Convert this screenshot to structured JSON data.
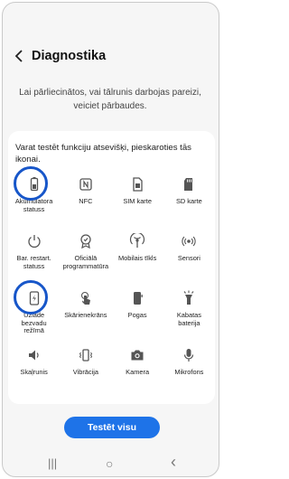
{
  "header": {
    "title": "Diagnostika"
  },
  "intro": {
    "text": "Lai pārliecinātos, vai tālrunis darbojas pareizi, veiciet pārbaudes."
  },
  "card": {
    "description": "Varat testēt funkciju atsevišķi, pieskaroties tās ikonai.",
    "items": [
      {
        "label": "Akumulatora\nstatuss",
        "icon": "battery-icon",
        "highlighted": true
      },
      {
        "label": "NFC",
        "icon": "nfc-icon",
        "highlighted": false
      },
      {
        "label": "SIM karte",
        "icon": "sim-card-icon",
        "highlighted": false
      },
      {
        "label": "SD karte",
        "icon": "sd-card-icon",
        "highlighted": false
      },
      {
        "label": "Bar. restart.\nstatuss",
        "icon": "power-restart-icon",
        "highlighted": false
      },
      {
        "label": "Oficiālā\nprogrammatūra",
        "icon": "certified-badge-icon",
        "highlighted": false
      },
      {
        "label": "Mobilais tīkls",
        "icon": "antenna-icon",
        "highlighted": false
      },
      {
        "label": "Sensori",
        "icon": "sensor-icon",
        "highlighted": false
      },
      {
        "label": "Uzlāde\nbezvadu\nrežīmā",
        "icon": "wireless-charging-icon",
        "highlighted": true
      },
      {
        "label": "Skārienekrāns",
        "icon": "touch-icon",
        "highlighted": false
      },
      {
        "label": "Pogas",
        "icon": "phone-buttons-icon",
        "highlighted": false
      },
      {
        "label": "Kabatas\nbaterija",
        "icon": "flashlight-icon",
        "highlighted": false
      },
      {
        "label": "Skaļrunis",
        "icon": "speaker-icon",
        "highlighted": false
      },
      {
        "label": "Vibrācija",
        "icon": "vibration-icon",
        "highlighted": false
      },
      {
        "label": "Kamera",
        "icon": "camera-icon",
        "highlighted": false
      },
      {
        "label": "Mikrofons",
        "icon": "microphone-icon",
        "highlighted": false
      }
    ]
  },
  "actions": {
    "test_all": "Testēt visu"
  },
  "nav": {
    "recents": "|||",
    "home": "○",
    "back": "‹"
  },
  "colors": {
    "accent": "#1e73e8",
    "highlight_ring": "#1756c9",
    "icon": "#555555"
  }
}
